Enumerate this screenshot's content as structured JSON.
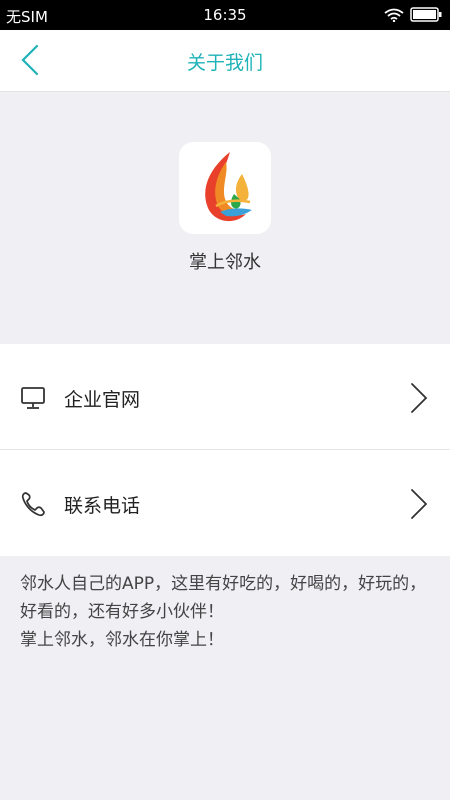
{
  "status_bar": {
    "carrier": "无SIM",
    "time": "16:35",
    "wifi_icon": "wifi-icon",
    "battery_icon": "battery-icon"
  },
  "nav": {
    "title": "关于我们",
    "back_icon": "chevron-left-icon"
  },
  "app": {
    "name": "掌上邻水",
    "logo": "flame-water-drop-logo"
  },
  "menu": {
    "items": [
      {
        "label": "企业官网",
        "icon": "monitor-icon"
      },
      {
        "label": "联系电话",
        "icon": "phone-icon"
      }
    ]
  },
  "about": {
    "line1": "邻水人自己的APP，这里有好吃的，好喝的，好玩的，好看的，还有好多小伙伴！",
    "line2": "掌上邻水，邻水在你掌上！"
  },
  "colors": {
    "accent": "#1fb3b8",
    "background": "#efeff4"
  }
}
